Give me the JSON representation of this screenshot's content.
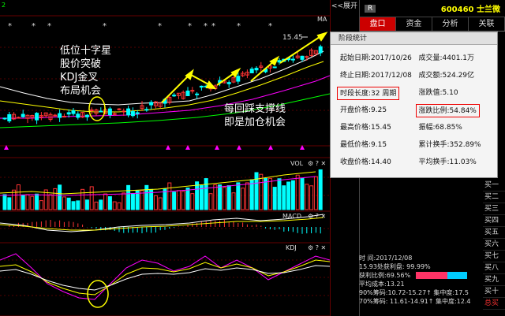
{
  "header": {
    "collapse_label": "<<展开",
    "stock_code_name": "600460 士兰微",
    "badge": "R"
  },
  "tabs": [
    {
      "label": "盘口",
      "active": true
    },
    {
      "label": "资金",
      "active": false
    },
    {
      "label": "分析",
      "active": false
    },
    {
      "label": "关联",
      "active": false
    }
  ],
  "chart": {
    "ma_label": "MA",
    "high_price_label": "15.45",
    "price_label_left": "2",
    "vol_label": "VOL",
    "macd_label": "MACD",
    "kdj_label": "KDJ",
    "unit_label": "X万",
    "kdj_ticks": [
      "80",
      "20"
    ]
  },
  "annotations": {
    "left_lines": [
      "低位十字星",
      "股价突破",
      "KDJ金叉",
      "布局机会"
    ],
    "right_lines": [
      "每回踩支撑线",
      "即是加仓机会"
    ]
  },
  "popup": {
    "title": "阶段统计",
    "rows": [
      [
        "起始日期:2017/10/26",
        "成交量:4401.1万"
      ],
      [
        "终止日期:2017/12/08",
        "成交额:524.29亿"
      ],
      [
        "时段长度:32 周期",
        "涨跌值:5.10"
      ],
      [
        "开盘价格:9.25",
        "涨跌比例:54.84%"
      ],
      [
        "最高价格:15.45",
        "振幅:68.85%"
      ],
      [
        "最低价格:9.15",
        "累计换手:352.89%"
      ],
      [
        "收盘价格:14.40",
        "平均换手:11.03%"
      ]
    ]
  },
  "buy_levels": [
    "买一",
    "买二",
    "买三",
    "买四",
    "买五",
    "买六",
    "买七",
    "买八",
    "买九",
    "买十",
    "总买"
  ],
  "bottom_info": {
    "time": "时       间:2017/12/08",
    "profit": "15.93处获利盘: 99.99%",
    "profit_ratio": "获利比例:69.56%",
    "avg_cost": "平均成本:13.21",
    "chip90": "90%筹码:10.72-15.27↑ 集中度:17.5",
    "chip70": "70%筹码: 11.61-14.91↑ 集中度:12.4"
  }
}
